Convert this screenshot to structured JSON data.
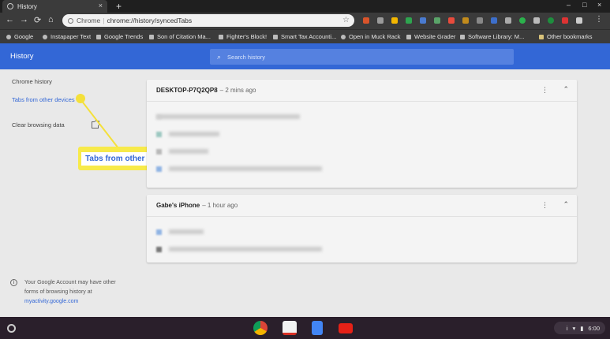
{
  "tab": {
    "title": "History",
    "close": "×"
  },
  "new_tab": "+",
  "window_controls": {
    "minimize": "–",
    "maximize": "□",
    "close": "×"
  },
  "toolbar": {
    "back": "←",
    "forward": "→",
    "reload": "⟳",
    "home": "⌂",
    "omnibox": {
      "host": "Chrome",
      "separator": "|",
      "url": "chrome://history/syncedTabs",
      "star": "☆"
    }
  },
  "bookmarks": [
    "Google",
    "Instapaper Text",
    "Google Trends",
    "Son of Citation Ma...",
    "Fighter's Block!",
    "Smart Tax Accounti...",
    "Open in Muck Rack",
    "Website Grader",
    "Software Library: M...",
    "Other bookmarks"
  ],
  "header": {
    "title": "History",
    "search_placeholder": "Search history",
    "search_icon": "⌕"
  },
  "sidebar": {
    "items": [
      {
        "label": "Chrome history"
      },
      {
        "label": "Tabs from other devices"
      },
      {
        "label": "Clear browsing data"
      }
    ],
    "footnote_text": "Your Google Account may have other forms of browsing history at ",
    "footnote_link": "myactivity.google.com",
    "info_icon": "i"
  },
  "callout": {
    "text": "Tabs from other devices"
  },
  "devices": [
    {
      "name": "DESKTOP-P7Q2QP8",
      "time": "– 2 mins ago",
      "menu": "⋮",
      "collapse": "⌃"
    },
    {
      "name": "Gabe's iPhone",
      "time": "– 1 hour ago",
      "menu": "⋮",
      "collapse": "⌃"
    }
  ],
  "colors": {
    "accent": "#3367d6",
    "callout": "#f4e03a"
  },
  "status": {
    "time": "6:00",
    "info": "i",
    "wifi": "▾",
    "battery": "▮"
  }
}
